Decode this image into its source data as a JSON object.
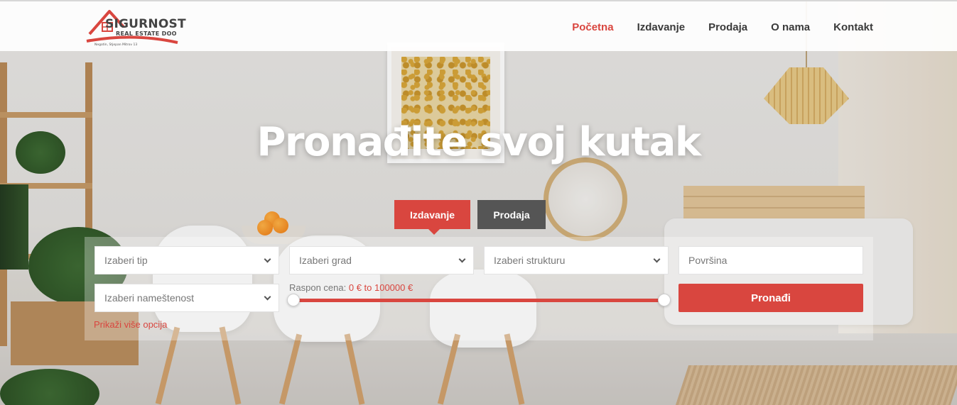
{
  "header": {
    "logo": {
      "name": "SIGURNOST",
      "subtitle": "REAL ESTATE DOO",
      "address": "Negotin, Stjepan Mitrov 13",
      "brand_color": "#d9463f"
    },
    "nav": [
      {
        "label": "Početna",
        "active": true
      },
      {
        "label": "Izdavanje",
        "active": false
      },
      {
        "label": "Prodaja",
        "active": false
      },
      {
        "label": "O nama",
        "active": false
      },
      {
        "label": "Kontakt",
        "active": false
      }
    ]
  },
  "hero": {
    "title": "Pronađite svoj kutak"
  },
  "search": {
    "tabs": [
      {
        "label": "Izdavanje",
        "active": true
      },
      {
        "label": "Prodaja",
        "active": false
      }
    ],
    "type_select": "Izaberi tip",
    "city_select": "Izaberi grad",
    "structure_select": "Izaberi strukturu",
    "area_placeholder": "Površina",
    "furnishing_select": "Izaberi nameštenost",
    "price_label": "Raspon cena:",
    "price_value": "0 € to 100000 €",
    "find_button": "Pronađi",
    "more_options": "Prikaži više opcija"
  },
  "colors": {
    "accent": "#d9463f",
    "secondary_tab": "#555555"
  }
}
